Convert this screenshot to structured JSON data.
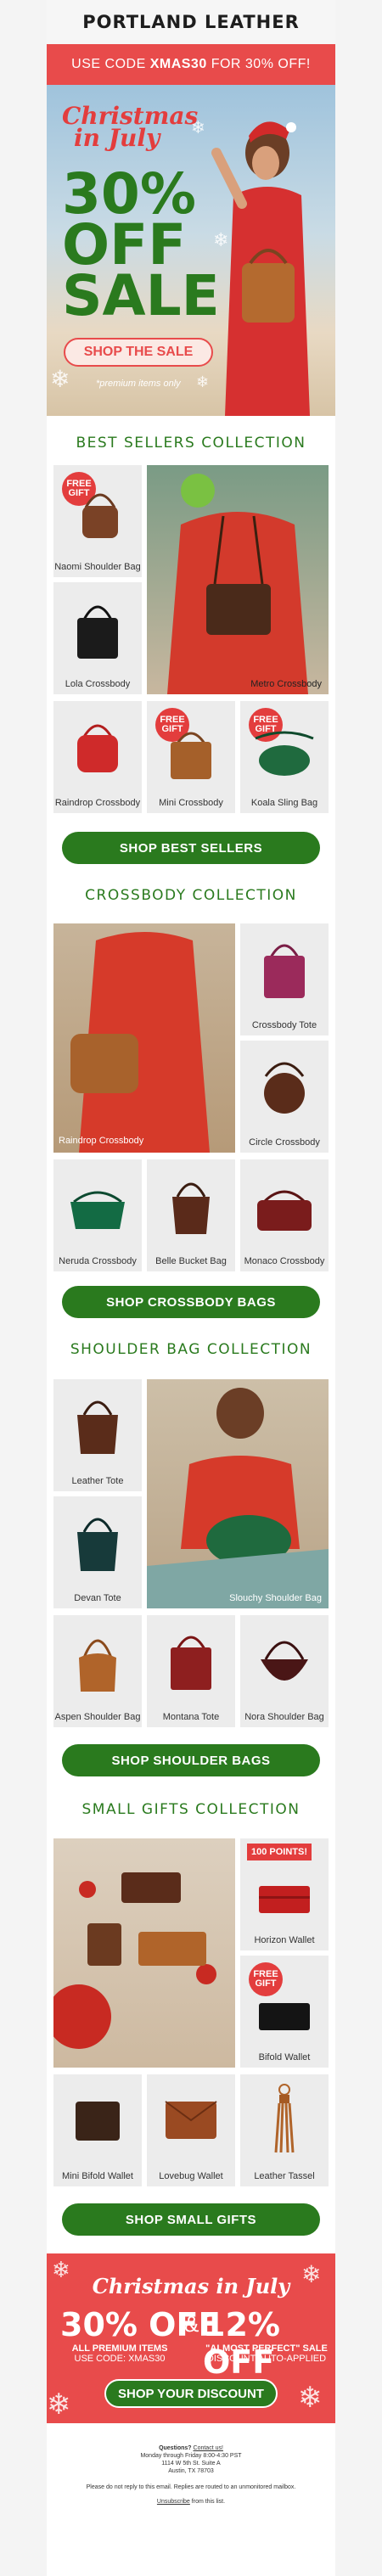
{
  "brand": "PORTLAND LEATHER",
  "promo_bar": {
    "prefix": "USE CODE ",
    "code": "XMAS30",
    "suffix": " FOR 30% OFF!"
  },
  "hero": {
    "script_line1": "Christmas",
    "script_line2": "in July",
    "line1": "30%",
    "line2": "OFF",
    "line3": "SALE",
    "button": "SHOP THE SALE",
    "note": "*premium items only"
  },
  "gift_badge": {
    "line1": "FREE",
    "line2": "GIFT"
  },
  "points_badge": "100 POINTS!",
  "sections": {
    "best": {
      "title": "BEST SELLERS COLLECTION",
      "items": [
        "Naomi Shoulder Bag",
        "Lola Crossbody",
        "Metro Crossbody",
        "Raindrop Crossbody",
        "Mini Crossbody",
        "Koala Sling Bag"
      ],
      "cta": "SHOP BEST SELLERS"
    },
    "crossbody": {
      "title": "CROSSBODY COLLECTION",
      "items": [
        "Raindrop Crossbody",
        "Crossbody Tote",
        "Circle Crossbody",
        "Neruda Crossbody",
        "Belle Bucket Bag",
        "Monaco Crossbody"
      ],
      "cta": "SHOP CROSSBODY BAGS"
    },
    "shoulder": {
      "title": "SHOULDER BAG COLLECTION",
      "items": [
        "Leather Tote",
        "Devan Tote",
        "Slouchy Shoulder Bag",
        "Aspen Shoulder Bag",
        "Montana Tote",
        "Nora Shoulder Bag"
      ],
      "cta": "SHOP SHOULDER BAGS"
    },
    "gifts": {
      "title": "SMALL GIFTS COLLECTION",
      "items": [
        "Horizon Wallet",
        "Bifold Wallet",
        "Mini Bifold Wallet",
        "Lovebug Wallet",
        "Leather Tassel"
      ],
      "cta": "SHOP SMALL GIFTS"
    }
  },
  "footer_promo": {
    "script": "Christmas in July",
    "left_big": "30% OFF",
    "amp": "&",
    "right_big": "12% OFF",
    "left_sub1": "ALL PREMIUM ITEMS",
    "left_sub2": "USE CODE: XMAS30",
    "right_sub1": "\"ALMOST PERFECT\" SALE",
    "right_sub2": "DISCOUNT AUTO-APPLIED",
    "button": "SHOP YOUR DISCOUNT"
  },
  "legal": {
    "q": "Questions? ",
    "contact": "Contact us!",
    "hours": "Monday through Friday 8:00-4:30 PST",
    "addr1": "1114 W 5th St. Suite A",
    "addr2": "Austin, TX 78703",
    "note": "Please do not reply to this email. Replies are routed to an unmonitored mailbox.",
    "unsub": "Unsubscribe",
    "unsub_suffix": " from this list."
  },
  "colors": {
    "red": "#e84b4b",
    "green": "#2a7a1e"
  }
}
